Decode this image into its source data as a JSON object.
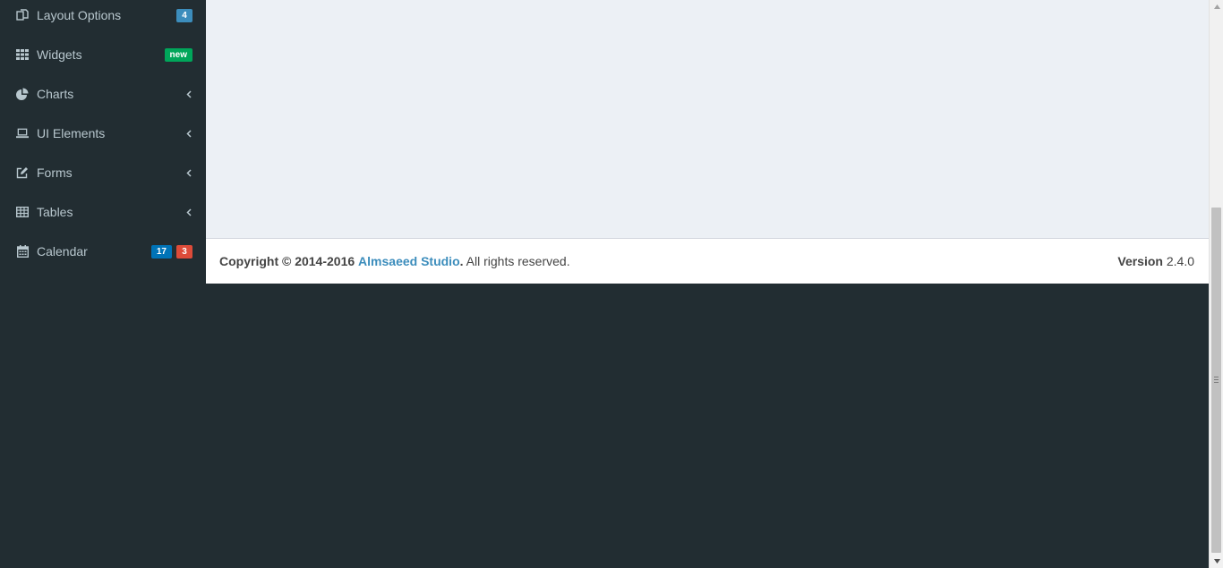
{
  "sidebar": {
    "items": [
      {
        "label": "Layout Options",
        "icon": "files-icon",
        "badges": [
          {
            "text": "4",
            "color": "#3c8dbc"
          }
        ]
      },
      {
        "label": "Widgets",
        "icon": "th-icon",
        "badges": [
          {
            "text": "new",
            "color": "#00a65a"
          }
        ]
      },
      {
        "label": "Charts",
        "icon": "pie-chart-icon",
        "chevron": true
      },
      {
        "label": "UI Elements",
        "icon": "laptop-icon",
        "chevron": true
      },
      {
        "label": "Forms",
        "icon": "edit-icon",
        "chevron": true
      },
      {
        "label": "Tables",
        "icon": "table-icon",
        "chevron": true
      },
      {
        "label": "Calendar",
        "icon": "calendar-icon",
        "badges": [
          {
            "text": "17",
            "color": "#0073b7"
          },
          {
            "text": "3",
            "color": "#dd4b39"
          }
        ]
      }
    ]
  },
  "footer": {
    "copyright_prefix": "Copyright © 2014-2016",
    "company": "Almsaeed Studio",
    "period": ".",
    "rights": "All rights reserved.",
    "version_label": "Version",
    "version_number": "2.4.0"
  },
  "colors": {
    "sidebar_bg": "#222d32",
    "sidebar_text": "#b8c7ce",
    "content_bg": "#ecf0f5",
    "link": "#3c8dbc"
  }
}
